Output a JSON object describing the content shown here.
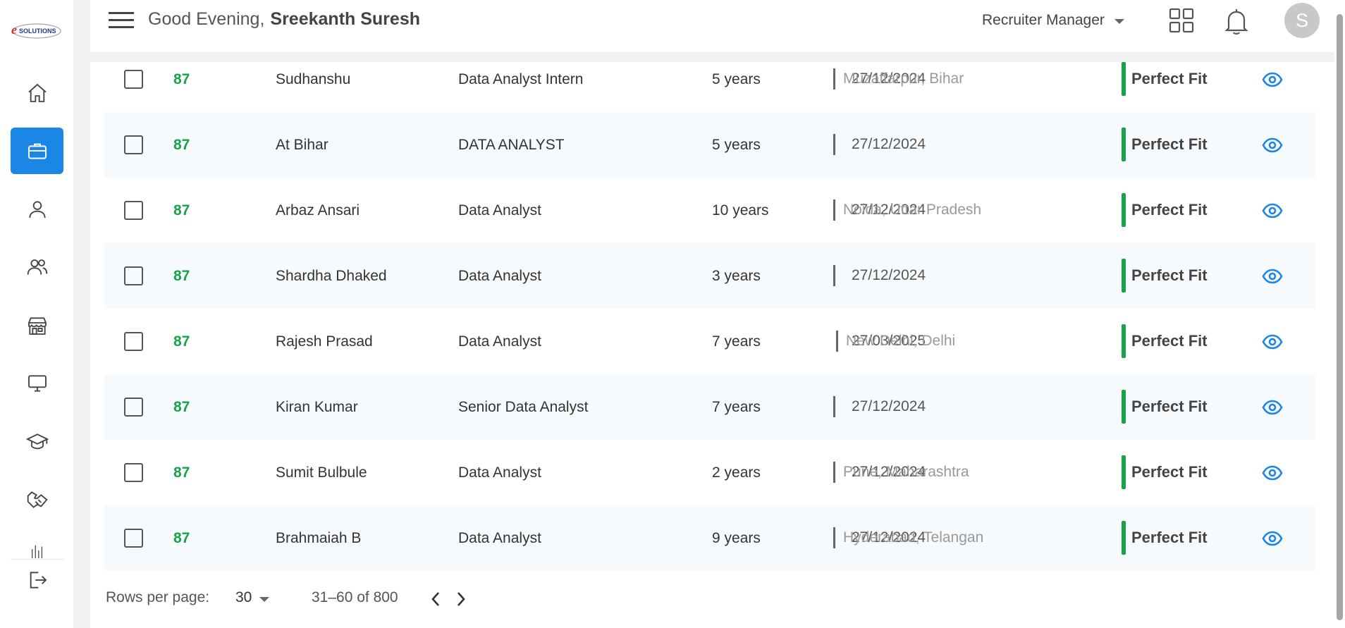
{
  "brand": {
    "logo_text": "eSOLUTIONS"
  },
  "header": {
    "greeting": "Good Evening,",
    "user_name": "Sreekanth Suresh",
    "role": "Recruiter Manager",
    "avatar_initial": "S"
  },
  "sidebar": {
    "items": [
      {
        "icon": "home-icon"
      },
      {
        "icon": "briefcase-icon",
        "active": true
      },
      {
        "icon": "person-icon"
      },
      {
        "icon": "people-icon"
      },
      {
        "icon": "store-icon"
      },
      {
        "icon": "monitor-icon"
      },
      {
        "icon": "graduation-cap-icon"
      },
      {
        "icon": "handshake-icon"
      },
      {
        "icon": "bar-chart-icon"
      }
    ],
    "logout_icon": "logout-icon"
  },
  "table": {
    "rows": [
      {
        "score": "87",
        "name": "Sudhanshu",
        "title": "Data Analyst Intern",
        "experience": "5 years",
        "date": "27/12/2024",
        "location": "Muzaffarpur, Bihar",
        "fit": "Perfect Fit"
      },
      {
        "score": "87",
        "name": "At Bihar",
        "title": "DATA ANALYST",
        "experience": "5 years",
        "date": "27/12/2024",
        "location": "",
        "fit": "Perfect Fit"
      },
      {
        "score": "87",
        "name": "Arbaz Ansari",
        "title": "Data Analyst",
        "experience": "10 years",
        "date": "27/12/2024",
        "location": "Noida, Uttar Pradesh",
        "fit": "Perfect Fit"
      },
      {
        "score": "87",
        "name": "Shardha Dhaked",
        "title": "Data Analyst",
        "experience": "3 years",
        "date": "27/12/2024",
        "location": "",
        "fit": "Perfect Fit"
      },
      {
        "score": "87",
        "name": "Rajesh Prasad",
        "title": "Data Analyst",
        "experience": "7 years",
        "date": "27/03/2025",
        "location": "New Delhi, Delhi",
        "fit": "Perfect Fit"
      },
      {
        "score": "87",
        "name": "Kiran Kumar",
        "title": "Senior Data Analyst",
        "experience": "7 years",
        "date": "27/12/2024",
        "location": "",
        "fit": "Perfect Fit"
      },
      {
        "score": "87",
        "name": "Sumit Bulbule",
        "title": "Data Analyst",
        "experience": "2 years",
        "date": "27/12/2024",
        "location": "Pune, Maharashtra",
        "fit": "Perfect Fit"
      },
      {
        "score": "87",
        "name": "Brahmaiah B",
        "title": "Data Analyst",
        "experience": "9 years",
        "date": "27/12/2024",
        "location": "Hyderabad, Telangan",
        "fit": "Perfect Fit"
      }
    ]
  },
  "pagination": {
    "rows_per_page_label": "Rows per page:",
    "rows_per_page_value": "30",
    "range_label": "31–60 of 800"
  },
  "colors": {
    "accent": "#1a86e6",
    "score": "#16a34a",
    "eye": "#1a86e6"
  }
}
